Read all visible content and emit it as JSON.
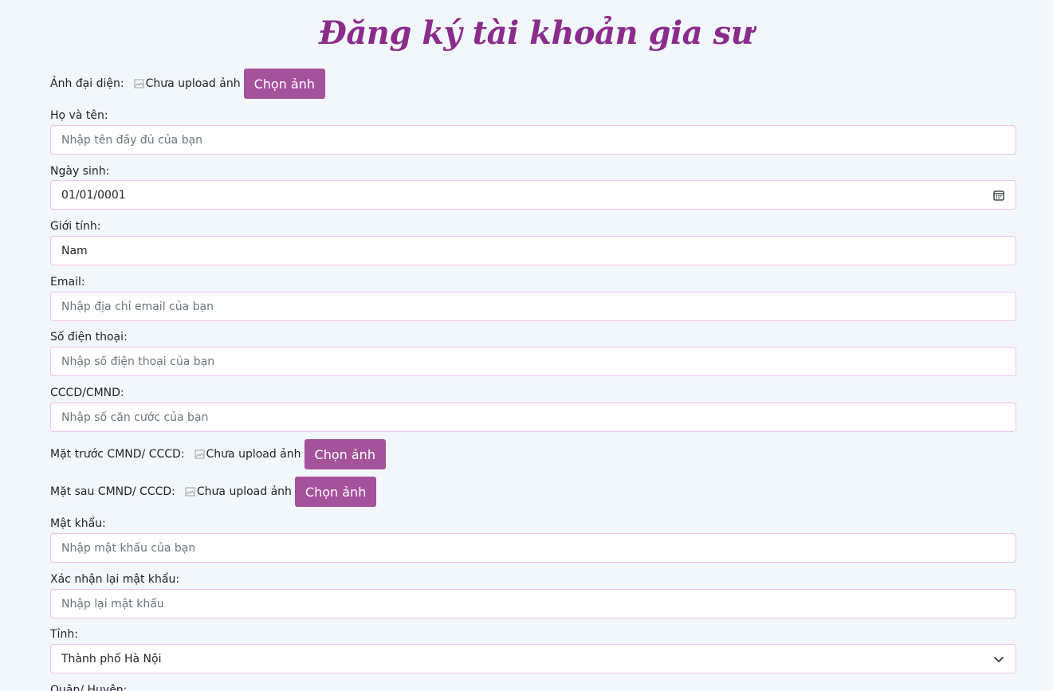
{
  "page": {
    "title": "Đăng ký tài khoản gia sư"
  },
  "colors": {
    "accent": "#a4529a",
    "title": "#8a2c8b",
    "input_border": "#f0c3ec",
    "background": "#f2f6fd"
  },
  "avatar": {
    "label": "Ảnh đại diện:",
    "img_alt": "Chưa upload ảnh",
    "button": "Chọn ảnh"
  },
  "fullname": {
    "label": "Họ và tên:",
    "placeholder": "Nhập tên đầy đủ của bạn"
  },
  "birthday": {
    "label": "Ngày sinh:",
    "value": "01/01/0001",
    "icon": "calendar-icon"
  },
  "gender": {
    "label": "Giới tính:",
    "value": "Nam"
  },
  "email": {
    "label": "Email:",
    "placeholder": "Nhập địa chỉ email của bạn"
  },
  "phone": {
    "label": "Số điện thoại:",
    "placeholder": "Nhập số điện thoại của bạn"
  },
  "cccd": {
    "label": "CCCD/CMND:",
    "placeholder": "Nhập số căn cước của bạn"
  },
  "id_front": {
    "label": "Mặt trước CMND/ CCCD:",
    "img_alt": "Chưa upload ảnh",
    "button": "Chọn ảnh"
  },
  "id_back": {
    "label": "Mặt sau CMND/ CCCD:",
    "img_alt": "Chưa upload ảnh",
    "button": "Chọn ảnh"
  },
  "password": {
    "label": "Mật khẩu:",
    "placeholder": "Nhập mật khẩu của bạn"
  },
  "confirm_password": {
    "label": "Xác nhận lại mật khẩu:",
    "placeholder": "Nhập lại mật khẩu"
  },
  "province": {
    "label": "Tỉnh:",
    "value": "Thành phố Hà Nội",
    "icon": "chevron-down-icon"
  },
  "district": {
    "label": "Quận/ Huyện:"
  }
}
